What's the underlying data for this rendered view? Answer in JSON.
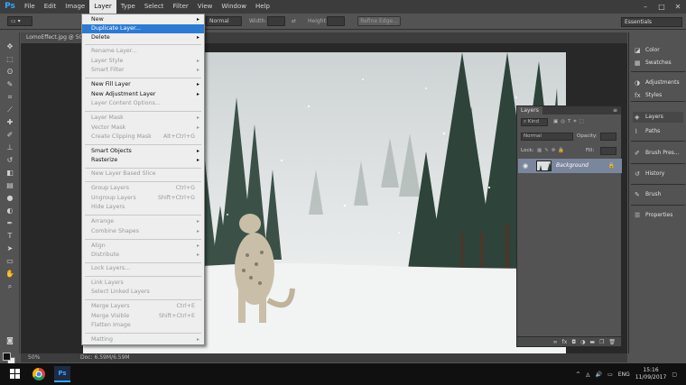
{
  "app": {
    "logo": "Ps",
    "menus": [
      "File",
      "Edit",
      "Image",
      "Layer",
      "Type",
      "Select",
      "Filter",
      "View",
      "Window",
      "Help"
    ],
    "active_menu": "Layer"
  },
  "options_bar": {
    "style_value": "Normal",
    "width_label": "Width:",
    "height_label": "Height:",
    "refine_edge": "Refine Edge...",
    "workspace": "Essentials"
  },
  "document": {
    "tab_title": "LomoEffect.jpg @ 50",
    "zoom": "50%",
    "doc_info": "Doc: 6.59M/6.59M"
  },
  "layer_menu": {
    "items": [
      {
        "label": "New",
        "submenu": true,
        "disabled": false
      },
      {
        "label": "Duplicate Layer...",
        "highlighted": true,
        "disabled": false
      },
      {
        "label": "Delete",
        "submenu": true,
        "disabled": false
      },
      {
        "label": "Rename Layer...",
        "disabled": true
      },
      {
        "label": "Layer Style",
        "submenu": true,
        "disabled": true
      },
      {
        "label": "Smart Filter",
        "submenu": true,
        "disabled": true
      },
      {
        "label": "New Fill Layer",
        "submenu": true,
        "disabled": false
      },
      {
        "label": "New Adjustment Layer",
        "submenu": true,
        "disabled": false
      },
      {
        "label": "Layer Content Options...",
        "disabled": true
      },
      {
        "label": "Layer Mask",
        "submenu": true,
        "disabled": true
      },
      {
        "label": "Vector Mask",
        "submenu": true,
        "disabled": true
      },
      {
        "label": "Create Clipping Mask",
        "shortcut": "Alt+Ctrl+G",
        "disabled": true
      },
      {
        "label": "Smart Objects",
        "submenu": true,
        "disabled": false
      },
      {
        "label": "Rasterize",
        "submenu": true,
        "disabled": false
      },
      {
        "label": "New Layer Based Slice",
        "disabled": true
      },
      {
        "label": "Group Layers",
        "shortcut": "Ctrl+G",
        "disabled": true
      },
      {
        "label": "Ungroup Layers",
        "shortcut": "Shift+Ctrl+G",
        "disabled": true
      },
      {
        "label": "Hide Layers",
        "disabled": true
      },
      {
        "label": "Arrange",
        "submenu": true,
        "disabled": true
      },
      {
        "label": "Combine Shapes",
        "submenu": true,
        "disabled": true
      },
      {
        "label": "Align",
        "submenu": true,
        "disabled": true
      },
      {
        "label": "Distribute",
        "submenu": true,
        "disabled": true
      },
      {
        "label": "Lock Layers...",
        "disabled": true
      },
      {
        "label": "Link Layers",
        "disabled": true
      },
      {
        "label": "Select Linked Layers",
        "disabled": true
      },
      {
        "label": "Merge Layers",
        "shortcut": "Ctrl+E",
        "disabled": true
      },
      {
        "label": "Merge Visible",
        "shortcut": "Shift+Ctrl+E",
        "disabled": true
      },
      {
        "label": "Flatten Image",
        "disabled": true
      },
      {
        "label": "Matting",
        "submenu": true,
        "disabled": true
      }
    ]
  },
  "layers_panel": {
    "tab": "Layers",
    "filter": "Kind",
    "blend_mode": "Normal",
    "opacity_label": "Opacity:",
    "lock_label": "Lock:",
    "fill_label": "Fill:",
    "layer_name": "Background"
  },
  "dock": {
    "items": [
      "Color",
      "Swatches",
      "Adjustments",
      "Styles",
      "Layers",
      "Paths",
      "Brush Pres...",
      "History",
      "Brush",
      "Properties"
    ]
  },
  "taskbar": {
    "language": "ENG",
    "time": "15:16",
    "date": "11/09/2017"
  }
}
